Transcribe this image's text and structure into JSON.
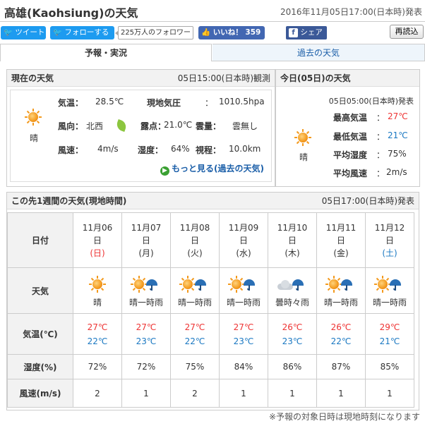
{
  "header": {
    "title": "高雄(Kaohsiung)の天気",
    "published": "2016年11月05日17:00(日本時)発表"
  },
  "social": {
    "tweet": "ツイート",
    "follow": "フォローする",
    "followers": "225万人のフォロワー",
    "like": "いいね！ 359",
    "share": "シェア",
    "reload": "再読込"
  },
  "tabs": [
    {
      "label": "予報・実況"
    },
    {
      "label": "過去の天気"
    }
  ],
  "current": {
    "title": "現在の天気",
    "observed": "05日15:00(日本時)観測",
    "weather": "晴",
    "temp_label": "気温：",
    "temp": "28.5℃",
    "pressure_label": "現地気圧",
    "pressure_sep": "：",
    "pressure": "1010.5hpa",
    "wind_dir_label": "風向：",
    "wind_dir": "北西",
    "dew_label": "露点：",
    "dew": "21.0℃",
    "cloud_label": "雲量：",
    "cloud": "雲無し",
    "wind_speed_label": "風速：",
    "wind_speed": "4m/s",
    "humidity_label": "湿度：",
    "humidity": "64%",
    "visibility_label": "視程：",
    "visibility": "10.0km",
    "more": "もっと見る(過去の天気)"
  },
  "today": {
    "title": "今日(05日)の天気",
    "published": "05日05:00(日本時)発表",
    "weather": "晴",
    "max_label": "最高気温",
    "max": "27℃",
    "min_label": "最低気温",
    "min": "21℃",
    "hum_label": "平均湿度",
    "hum": "75%",
    "wind_label": "平均風速",
    "wind": "2m/s",
    "colon": "："
  },
  "week": {
    "title": "この先1週間の天気(現地時間)",
    "published": "05日17:00(日本時)発表",
    "row_labels": {
      "date": "日付",
      "weather": "天気",
      "temp": "気温(℃)",
      "humidity": "湿度(%)",
      "wind": "風速(m/s)"
    },
    "days": [
      {
        "month_day": "11月06",
        "day": "日",
        "dow": "(日)",
        "icon": "sun-icon",
        "weather": "晴",
        "hi": "27℃",
        "lo": "22℃",
        "humidity": "72%",
        "wind": "2"
      },
      {
        "month_day": "11月07",
        "day": "日",
        "dow": "(月)",
        "icon": "sun-umbrella-icon",
        "weather": "晴一時雨",
        "hi": "27℃",
        "lo": "23℃",
        "humidity": "72%",
        "wind": "1"
      },
      {
        "month_day": "11月08",
        "day": "日",
        "dow": "(火)",
        "icon": "sun-umbrella-icon",
        "weather": "晴一時雨",
        "hi": "27℃",
        "lo": "22℃",
        "humidity": "75%",
        "wind": "2"
      },
      {
        "month_day": "11月09",
        "day": "日",
        "dow": "(水)",
        "icon": "sun-umbrella-icon",
        "weather": "晴一時雨",
        "hi": "27℃",
        "lo": "23℃",
        "humidity": "84%",
        "wind": "1"
      },
      {
        "month_day": "11月10",
        "day": "日",
        "dow": "(木)",
        "icon": "cloud-umbrella-icon",
        "weather": "曇時々雨",
        "hi": "26℃",
        "lo": "23℃",
        "humidity": "86%",
        "wind": "1"
      },
      {
        "month_day": "11月11",
        "day": "日",
        "dow": "(金)",
        "icon": "sun-umbrella-icon",
        "weather": "晴一時雨",
        "hi": "26℃",
        "lo": "22℃",
        "humidity": "87%",
        "wind": "1"
      },
      {
        "month_day": "11月12",
        "day": "日",
        "dow": "(土)",
        "icon": "sun-umbrella-icon",
        "weather": "晴一時雨",
        "hi": "29℃",
        "lo": "21℃",
        "humidity": "85%",
        "wind": "1"
      }
    ],
    "note": "※予報の対象日時は現地時刻になります"
  }
}
